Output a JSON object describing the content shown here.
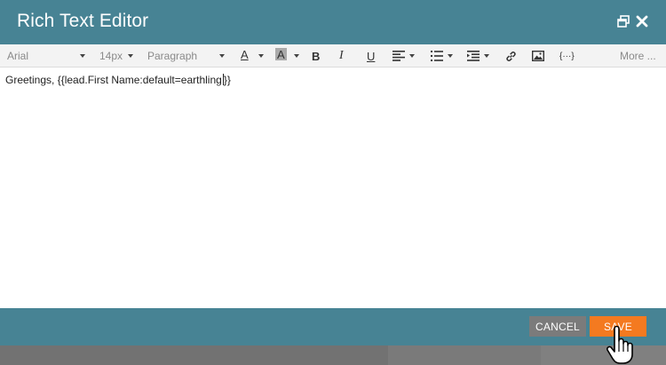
{
  "window": {
    "title": "Rich Text Editor",
    "restore_icon": "restore-window-icon",
    "close_icon": "close-icon"
  },
  "toolbar": {
    "font_family": "Arial",
    "font_size": "14px",
    "block_format": "Paragraph",
    "font_color_letter": "A",
    "bg_color_letter": "A",
    "bold": "B",
    "italic": "I",
    "underline": "U",
    "more": "More ..."
  },
  "editor": {
    "text": "Greetings, {{lead.First Name:default=earthling",
    "text_after_cursor": "}}"
  },
  "footer": {
    "cancel_label": "CANCEL",
    "save_label": "SAVE"
  },
  "colors": {
    "header": "#478394",
    "save": "#f47a20",
    "cancel": "#7b7b7b"
  }
}
